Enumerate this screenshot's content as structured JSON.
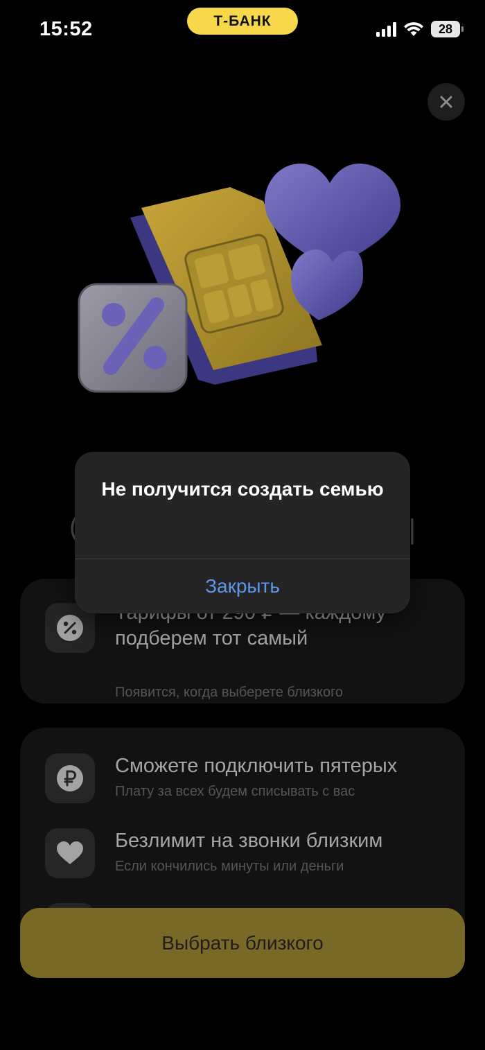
{
  "status_bar": {
    "time": "15:52",
    "bank_label": "Т-БАНК",
    "battery": "28"
  },
  "alert": {
    "title": "Не получится создать семью",
    "close_label": "Закрыть"
  },
  "card_1": {
    "title": "Тарифы от 290 ₽ — каждому подберем тот самый",
    "subtitle": "Появится, когда выберете близкого",
    "icon": "percent-icon"
  },
  "card_2": {
    "items": [
      {
        "title": "Сможете подключить пятерых",
        "subtitle": "Плату за всех будем списывать с вас",
        "icon": "ruble-icon"
      },
      {
        "title": "Безлимит на звонки близким",
        "subtitle": "Если кончились минуты или деньги",
        "icon": "heart-icon"
      }
    ]
  },
  "primary_button": {
    "label": "Выбрать близкого"
  },
  "colors": {
    "brand_yellow": "#f7d84a",
    "button_dimmed": "#786a26",
    "alert_bg": "#252525",
    "alert_action": "#5a96ec",
    "card_bg": "#121212"
  }
}
